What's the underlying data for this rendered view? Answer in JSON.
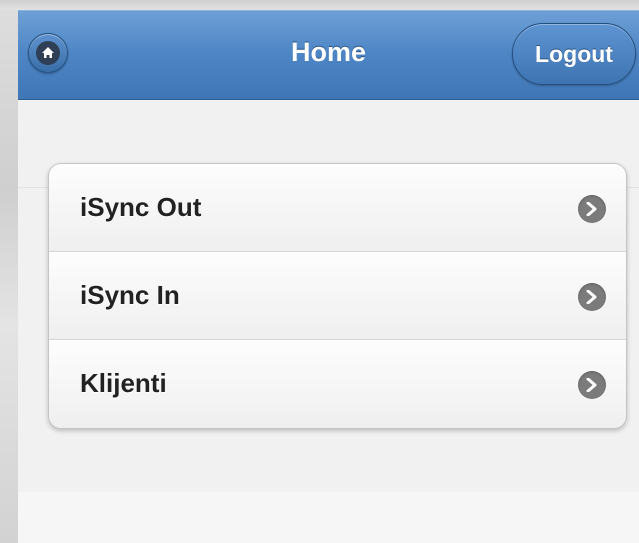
{
  "header": {
    "title": "Home",
    "home_icon": "home-icon",
    "logout_label": "Logout",
    "color": "#4f87c6"
  },
  "menu": {
    "items": [
      {
        "label": "iSync Out",
        "icon": "chevron-right-icon"
      },
      {
        "label": "iSync In",
        "icon": "chevron-right-icon"
      },
      {
        "label": "Klijenti",
        "icon": "chevron-right-icon"
      }
    ]
  }
}
